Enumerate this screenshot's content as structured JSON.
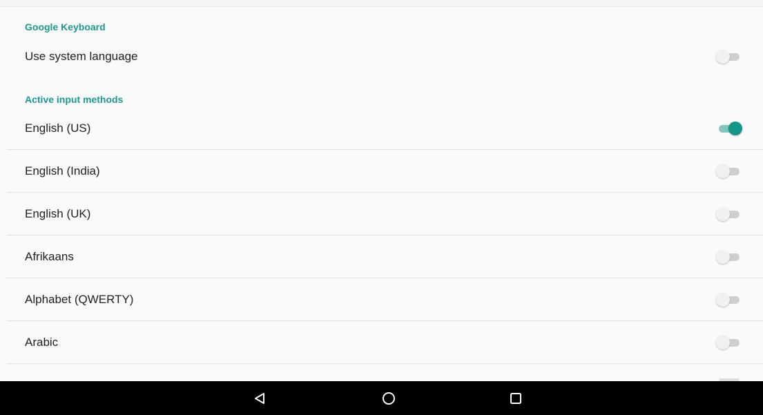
{
  "sections": {
    "keyboard_header": "Google Keyboard",
    "input_methods_header": "Active input methods"
  },
  "settings": {
    "use_system_language": {
      "label": "Use system language",
      "enabled": false
    }
  },
  "input_methods": [
    {
      "label": "English (US)",
      "enabled": true
    },
    {
      "label": "English (India)",
      "enabled": false
    },
    {
      "label": "English (UK)",
      "enabled": false
    },
    {
      "label": "Afrikaans",
      "enabled": false
    },
    {
      "label": "Alphabet (QWERTY)",
      "enabled": false
    },
    {
      "label": "Arabic",
      "enabled": false
    }
  ],
  "navbar": {
    "back_icon": "back-triangle-icon",
    "home_icon": "home-circle-icon",
    "recents_icon": "recents-square-icon"
  },
  "colors": {
    "accent": "#1a9a8f",
    "toggle_on_thumb": "#129688",
    "toggle_on_track": "#80c7bf",
    "toggle_off_track": "#cfcfcf",
    "background": "#fafafa",
    "navbar": "#000000"
  }
}
